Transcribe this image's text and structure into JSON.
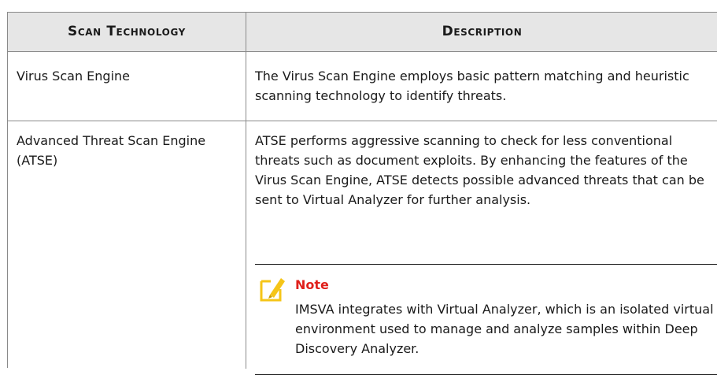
{
  "table": {
    "headers": [
      "Scan Technology",
      "Description"
    ],
    "rows": [
      {
        "technology": "Virus Scan Engine",
        "description": "The Virus Scan Engine employs basic pattern matching and heuristic scanning technology to identify threats."
      },
      {
        "technology": "Advanced Threat Scan Engine (ATSE)",
        "description": "ATSE performs aggressive scanning to check for less conventional threats such as document exploits. By enhancing the features of the Virus Scan Engine, ATSE detects possible advanced threats that can be sent to Virtual Analyzer for further analysis."
      }
    ],
    "note": {
      "icon": "note-pencil-icon",
      "label": "Note",
      "text": "IMSVA integrates with Virtual Analyzer, which is an isolated virtual environment used to manage and analyze samples within Deep Discovery Analyzer."
    }
  },
  "colors": {
    "header_bg": "#e6e6e6",
    "note_label": "#e0201b",
    "note_icon_fill": "#f5c518"
  }
}
